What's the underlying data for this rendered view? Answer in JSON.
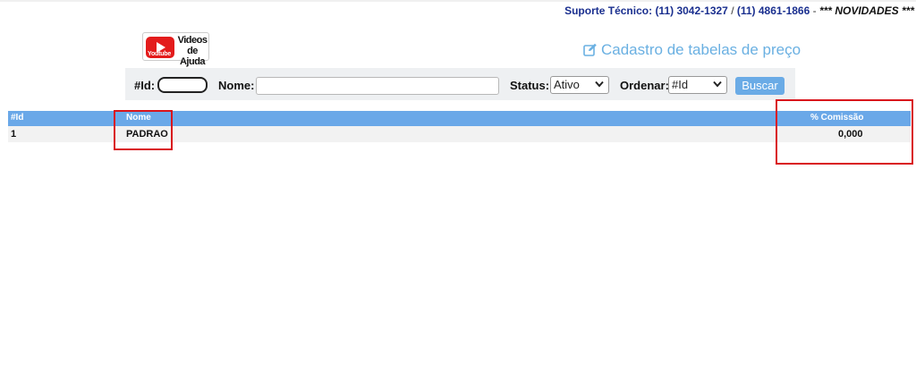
{
  "header": {
    "support_label": "Suporte Técnico:",
    "phone_1": "(11) 3042-1327",
    "phone_sep": "/",
    "phone_2": "(11) 4861-1866",
    "dash": "-",
    "news": "*** NOVIDADES ***"
  },
  "logo": {
    "youtube": "Youtube",
    "line1": "Videos",
    "line2": "de Ajuda",
    "icon": "youtube-play-icon"
  },
  "page": {
    "title": "Cadastro de tabelas de preço",
    "title_icon": "edit-icon"
  },
  "filters": {
    "id_label": "#Id:",
    "id_value": "",
    "nome_label": "Nome:",
    "nome_value": "",
    "status_label": "Status:",
    "status_value": "Ativo",
    "ordenar_label": "Ordenar:",
    "ordenar_value": "#Id",
    "search_button": "Buscar"
  },
  "table": {
    "columns": [
      "#Id",
      "Nome",
      "% Comissão"
    ],
    "rows": [
      {
        "id": "1",
        "nome": "PADRAO",
        "comissao": "0,000"
      }
    ],
    "header_color": "#6aa8e8"
  },
  "annotation_color": "#d9141b"
}
